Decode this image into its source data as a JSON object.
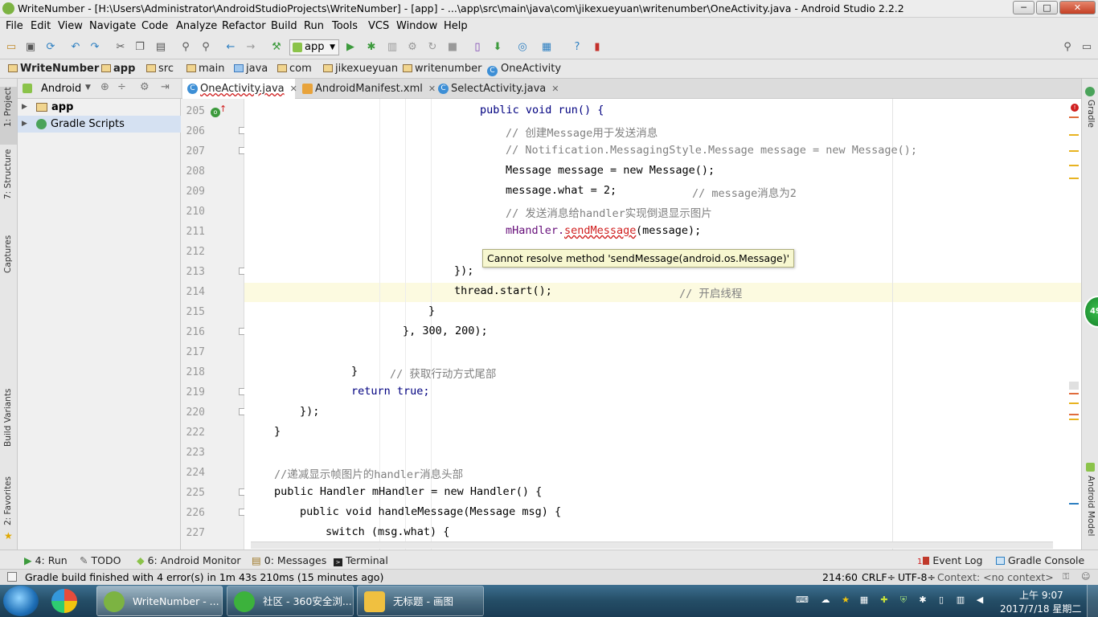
{
  "window": {
    "title": "WriteNumber - [H:\\Users\\Administrator\\AndroidStudioProjects\\WriteNumber] - [app] - ...\\app\\src\\main\\java\\com\\jikexueyuan\\writenumber\\OneActivity.java - Android Studio 2.2.2",
    "minimize": "─",
    "maximize": "□",
    "close": "✕"
  },
  "menu": [
    "File",
    "Edit",
    "View",
    "Navigate",
    "Code",
    "Analyze",
    "Refactor",
    "Build",
    "Run",
    "Tools",
    "VCS",
    "Window",
    "Help"
  ],
  "toolbar": {
    "run_config": "app"
  },
  "breadcrumbs": [
    "WriteNumber",
    "app",
    "src",
    "main",
    "java",
    "com",
    "jikexueyuan",
    "writenumber",
    "OneActivity"
  ],
  "project_panel": {
    "view": "Android",
    "tree": [
      {
        "label": "app",
        "icon": "folder-icon"
      },
      {
        "label": "Gradle Scripts",
        "icon": "gradle-icon"
      }
    ]
  },
  "left_tabs": [
    "1: Project",
    "7: Structure",
    "Captures",
    "Build Variants",
    "2: Favorites"
  ],
  "right_tabs": [
    "Gradle",
    "Android Model"
  ],
  "editor_tabs": [
    {
      "label": "OneActivity.java",
      "active": true
    },
    {
      "label": "AndroidManifest.xml",
      "active": false
    },
    {
      "label": "SelectActivity.java",
      "active": false
    }
  ],
  "code_lines": [
    {
      "n": "205",
      "text": "public void run() {"
    },
    {
      "n": "206",
      "text": "// 创建Message用于发送消息"
    },
    {
      "n": "207",
      "text": "// Notification.MessagingStyle.Message message = new Message();"
    },
    {
      "n": "208",
      "text": "Message message = new Message();"
    },
    {
      "n": "209",
      "text": "message.what = 2;"
    },
    {
      "n": "209c",
      "text": "// message消息为2"
    },
    {
      "n": "210",
      "text": "// 发送消息给handler实现倒退显示图片"
    },
    {
      "n": "211a",
      "text": "mHandler."
    },
    {
      "n": "211b",
      "text": "sendMessage"
    },
    {
      "n": "211c",
      "text": "(message);"
    },
    {
      "n": "213",
      "text": "});"
    },
    {
      "n": "214",
      "text": "thread.start();"
    },
    {
      "n": "214c",
      "text": "// 开启线程"
    },
    {
      "n": "215",
      "text": "}"
    },
    {
      "n": "216",
      "text": "}, 300, 200);"
    },
    {
      "n": "218",
      "text": "}"
    },
    {
      "n": "218c",
      "text": "// 获取行动方式尾部"
    },
    {
      "n": "219",
      "text": "return true;"
    },
    {
      "n": "220",
      "text": "});"
    },
    {
      "n": "222",
      "text": "}"
    },
    {
      "n": "224",
      "text": "//递减显示帧图片的handler消息头部"
    },
    {
      "n": "225",
      "text": "public Handler mHandler = new Handler() {"
    },
    {
      "n": "226",
      "text": "public void handleMessage(Message msg) {"
    },
    {
      "n": "227",
      "text": "switch (msg.what) {"
    }
  ],
  "line_numbers": [
    "205",
    "206",
    "207",
    "208",
    "209",
    "210",
    "211",
    "212",
    "213",
    "214",
    "215",
    "216",
    "217",
    "218",
    "219",
    "220",
    "222",
    "223",
    "224",
    "225",
    "226",
    "227"
  ],
  "tooltip": "Cannot resolve method 'sendMessage(android.os.Message)'",
  "bottom_tabs": [
    {
      "label": "4: Run",
      "icon": "run-icon"
    },
    {
      "label": "TODO",
      "icon": "todo-icon"
    },
    {
      "label": "6: Android Monitor",
      "icon": "android-icon"
    },
    {
      "label": "0: Messages",
      "icon": "messages-icon"
    },
    {
      "label": "Terminal",
      "icon": "terminal-icon"
    }
  ],
  "bottom_right_tabs": [
    {
      "label": "Event Log",
      "badge": "1"
    },
    {
      "label": "Gradle Console"
    }
  ],
  "status": {
    "message": "Gradle build finished with 4 error(s) in 1m 43s 210ms (15 minutes ago)",
    "position": "214:60",
    "line_sep": "CRLF÷",
    "encoding": "UTF-8÷",
    "context": "Context: <no context>"
  },
  "side_badge": "49",
  "taskbar": {
    "tasks": [
      "WriteNumber - ...",
      "社区 - 360安全浏...",
      "无标题 - 画图"
    ],
    "time": "上午 9:07",
    "date": "2017/7/18 星期二"
  },
  "colors": {
    "accent": "#3d8fd6",
    "error": "#d01f1f",
    "tooltip_bg": "#f7f7d0",
    "current_line": "#fcfae0"
  }
}
